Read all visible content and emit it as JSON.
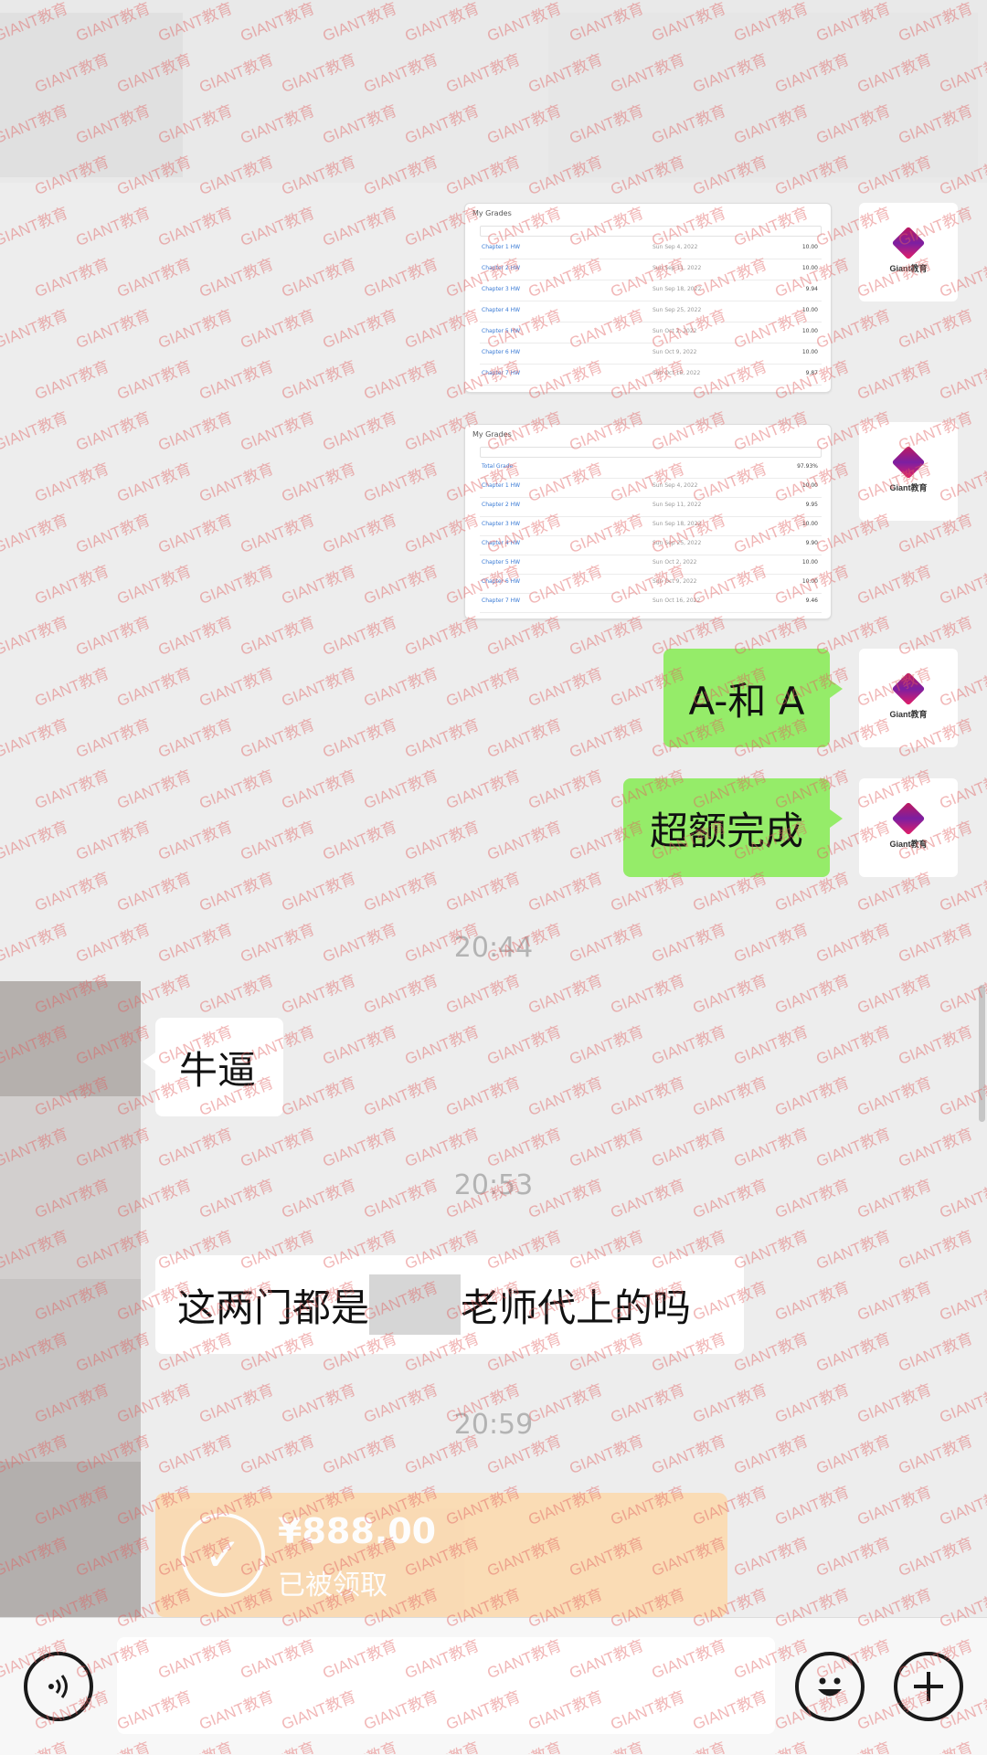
{
  "watermark": "GIANT教育",
  "logo_text": "Giant教育",
  "messages": {
    "outgoing_1": "A-和 A",
    "outgoing_2": "超额完成",
    "incoming_1": "牛逼",
    "incoming_2_prefix": "这两门都是",
    "incoming_2_suffix": "老师代上的吗"
  },
  "timestamps": [
    "20:44",
    "20:53",
    "20:59"
  ],
  "red_packet": {
    "amount": "¥888.00",
    "status": "已被领取"
  },
  "screenshots": [
    {
      "title": "My Grades",
      "rows": [
        {
          "left": "Chapter 1 HW",
          "mid": "Sun Sep 4, 2022",
          "right": "10.00"
        },
        {
          "left": "Chapter 2 HW",
          "mid": "Sun Sep 11, 2022",
          "right": "10.00"
        },
        {
          "left": "Chapter 3 HW",
          "mid": "Sun Sep 18, 2022",
          "right": "9.94"
        },
        {
          "left": "Chapter 4 HW",
          "mid": "Sun Sep 25, 2022",
          "right": "10.00"
        },
        {
          "left": "Chapter 5 HW",
          "mid": "Sun Oct 2, 2022",
          "right": "10.00"
        },
        {
          "left": "Chapter 6 HW",
          "mid": "Sun Oct 9, 2022",
          "right": "10.00"
        },
        {
          "left": "Chapter 7 HW",
          "mid": "Sun Oct 16, 2022",
          "right": "9.87"
        }
      ]
    },
    {
      "title": "My Grades",
      "rows": [
        {
          "left": "Total Grade",
          "mid": "",
          "right": "97.93%"
        },
        {
          "left": "Chapter 1 HW",
          "mid": "Sun Sep 4, 2022",
          "right": "10.00"
        },
        {
          "left": "Chapter 2 HW",
          "mid": "Sun Sep 11, 2022",
          "right": "9.95"
        },
        {
          "left": "Chapter 3 HW",
          "mid": "Sun Sep 18, 2022",
          "right": "10.00"
        },
        {
          "left": "Chapter 4 HW",
          "mid": "Sun Sep 25, 2022",
          "right": "9.90"
        },
        {
          "left": "Chapter 5 HW",
          "mid": "Sun Oct 2, 2022",
          "right": "10.00"
        },
        {
          "left": "Chapter 6 HW",
          "mid": "Sun Oct 9, 2022",
          "right": "10.00"
        },
        {
          "left": "Chapter 7 HW",
          "mid": "Sun Oct 16, 2022",
          "right": "9.46"
        }
      ]
    }
  ],
  "icons": {
    "voice": "voice-icon",
    "emoji": "emoji-icon",
    "more": "plus-icon",
    "packet": "check-icon"
  }
}
